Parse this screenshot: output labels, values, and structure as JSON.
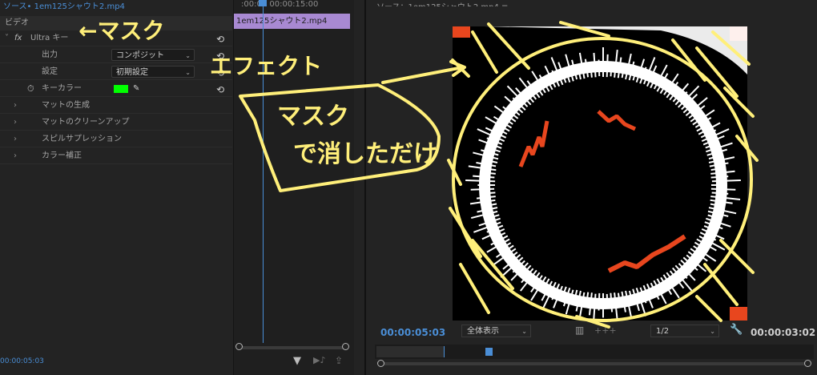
{
  "effect_controls": {
    "source_tab": "ソース• 1em125シャウト2.mp4",
    "video_header": "ビデオ",
    "effect_name": "Ultra キー",
    "rows": {
      "output_label": "出力",
      "output_value": "コンポジット",
      "settings_label": "設定",
      "settings_value": "初期設定",
      "key_color_label": "キーカラー",
      "key_color": "#00ff00",
      "matte_generation": "マットの生成",
      "matte_cleanup": "マットのクリーンアップ",
      "spill_suppression": "スピルサプレッション",
      "color_correction": "カラー補正"
    },
    "bottom_timecode": "00:00:05:03"
  },
  "mini_timeline": {
    "ruler_label": ":00:00          00:00:15:00",
    "clip_name": "1em125シャウト2.mp4",
    "clip_color": "#a889d2"
  },
  "program_monitor": {
    "tab_title": "ソース：1em125シャウト2.mp4 ≡",
    "current_timecode": "00:00:05:03",
    "zoom_value": "全体表示",
    "resolution_value": "1/2",
    "duration_timecode": "00:00:03:02"
  },
  "annotations": {
    "mask_arrow_text": "←マスク",
    "effect_text": "エフェクト",
    "balloon_text_line1": "マスク",
    "balloon_text_line2": "で消しただけ",
    "highlight_color": "#ffef7a"
  }
}
